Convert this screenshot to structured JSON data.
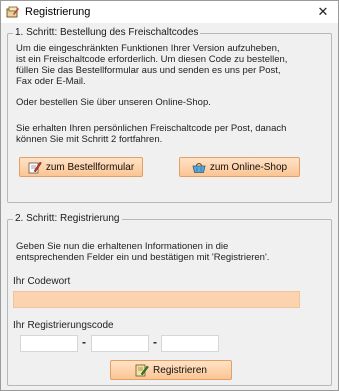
{
  "window": {
    "title": "Registrierung",
    "close_glyph": "✕",
    "app_icon": "registration-app-icon"
  },
  "step1": {
    "legend": "1. Schritt: Bestellung des Freischaltcodes",
    "para1_line1": "Um die eingeschränkten Funktionen Ihrer Version aufzuheben,",
    "para1_line2": "ist ein Freischaltcode erforderlich. Um diesen Code zu bestellen,",
    "para1_line3": "füllen Sie das Bestellformular aus und senden es uns per Post,",
    "para1_line4": "Fax oder E-Mail.",
    "para2": "Oder bestellen Sie über unseren Online-Shop.",
    "para3_line1": "Sie erhalten Ihren persönlichen Freischaltcode per Post, danach",
    "para3_line2": "können Sie mit Schritt 2 fortfahren.",
    "order_form_button": "zum Bestellformular",
    "order_form_icon": "form-pencil-icon",
    "online_shop_button": "zum Online-Shop",
    "online_shop_icon": "shopping-basket-icon"
  },
  "step2": {
    "legend": "2. Schritt: Registrierung",
    "para_line1": "Geben Sie nun die erhaltenen Informationen in die",
    "para_line2": "entsprechenden Felder ein und bestätigen mit 'Registrieren'.",
    "codeword_label": "Ihr Codewort",
    "codeword_value": "",
    "regcode_label": "Ihr Registrierungscode",
    "regcode_part1": "",
    "regcode_part2": "",
    "regcode_part3": "",
    "separator": "-",
    "register_button": "Registrieren",
    "register_icon": "register-pencil-icon"
  },
  "colors": {
    "button_bg": "#fcc593",
    "codeword_field_bg": "#fbd3ae",
    "window_bg": "#f0f0f0"
  }
}
